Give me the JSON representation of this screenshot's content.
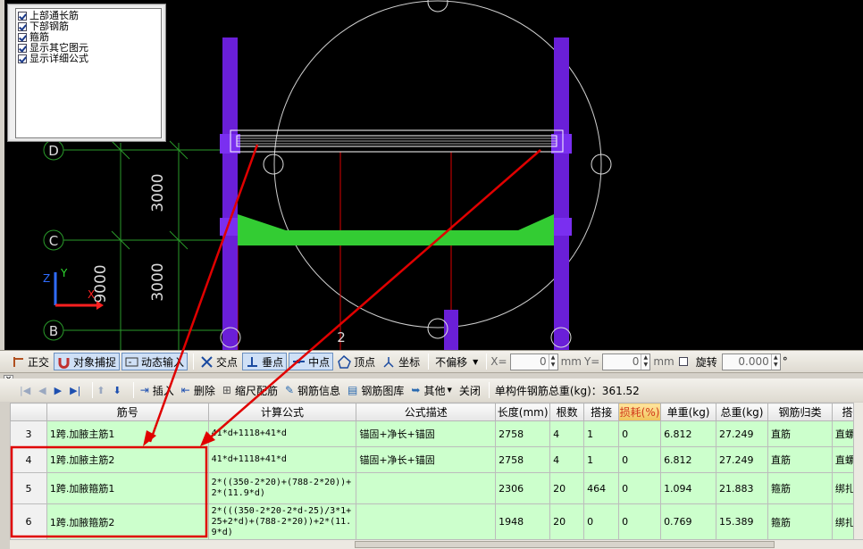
{
  "layers": {
    "items": [
      {
        "label": "上部通长筋",
        "checked": true
      },
      {
        "label": "下部钢筋",
        "checked": true
      },
      {
        "label": "箍筋",
        "checked": true
      },
      {
        "label": "显示其它图元",
        "checked": true
      },
      {
        "label": "显示详细公式",
        "checked": true
      }
    ]
  },
  "canvas": {
    "axis_labels": [
      "D",
      "C",
      "B",
      "2"
    ],
    "dimensions": [
      "3000",
      "3000",
      "9000"
    ],
    "coord_axes": [
      "Z",
      "Y",
      "X"
    ]
  },
  "snap_toolbar": {
    "ortho": "正交",
    "object_snap": "对象捕捉",
    "dynamic_input": "动态输入",
    "intersection": "交点",
    "perpendicular": "垂点",
    "midpoint": "中点",
    "vertex": "顶点",
    "coordinate": "坐标",
    "offset_select": "不偏移",
    "x_label": "X=",
    "x_value": "0",
    "x_unit": "mm",
    "y_label": "Y=",
    "y_value": "0",
    "y_unit": "mm",
    "rotate_label": "旋转",
    "rotate_value": "0.000",
    "degree": "°"
  },
  "rebar_toolbar": {
    "insert": "插入",
    "delete": "删除",
    "ruler_config": "缩尺配筋",
    "rebar_info": "钢筋信息",
    "rebar_library": "钢筋图库",
    "other": "其他",
    "close": "关闭",
    "total_weight": "单构件钢筋总重(kg)：361.52"
  },
  "table": {
    "headers": [
      "",
      "筋号",
      "计算公式",
      "公式描述",
      "长度(mm)",
      "根数",
      "搭接",
      "损耗(%)",
      "单重(kg)",
      "总重(kg)",
      "钢筋归类",
      "搭"
    ],
    "rows": [
      {
        "num": "3",
        "name": "1跨.加腋主筋1",
        "formula": "41*d+1118+41*d",
        "desc": "锚固+净长+锚固",
        "length": "2758",
        "count": "4",
        "lap": "1",
        "loss": "0",
        "unit_weight": "6.812",
        "total_weight": "27.249",
        "category": "直筋",
        "extra": "直螺"
      },
      {
        "num": "4",
        "name": "1跨.加腋主筋2",
        "formula": "41*d+1118+41*d",
        "desc": "锚固+净长+锚固",
        "length": "2758",
        "count": "4",
        "lap": "1",
        "loss": "0",
        "unit_weight": "6.812",
        "total_weight": "27.249",
        "category": "直筋",
        "extra": "直螺"
      },
      {
        "num": "5",
        "name": "1跨.加腋箍筋1",
        "formula": "2*((350-2*20)+(788-2*20))+2*(11.9*d)",
        "desc": "",
        "length": "2306",
        "count": "20",
        "lap": "464",
        "loss": "0",
        "unit_weight": "1.094",
        "total_weight": "21.883",
        "category": "箍筋",
        "extra": "绑扎"
      },
      {
        "num": "6",
        "name": "1跨.加腋箍筋2",
        "formula": "2*(((350-2*20-2*d-25)/3*1+25+2*d)+(788-2*20))+2*(11.9*d)",
        "desc": "",
        "length": "1948",
        "count": "20",
        "lap": "0",
        "loss": "0",
        "unit_weight": "0.769",
        "total_weight": "15.389",
        "category": "箍筋",
        "extra": "绑扎"
      }
    ]
  },
  "colors": {
    "canvas_bg": "#000000",
    "column": "#6a1fd8",
    "beam_green": "#33cc33",
    "annotation_red": "#e00000",
    "row_green": "#ccffcc"
  }
}
